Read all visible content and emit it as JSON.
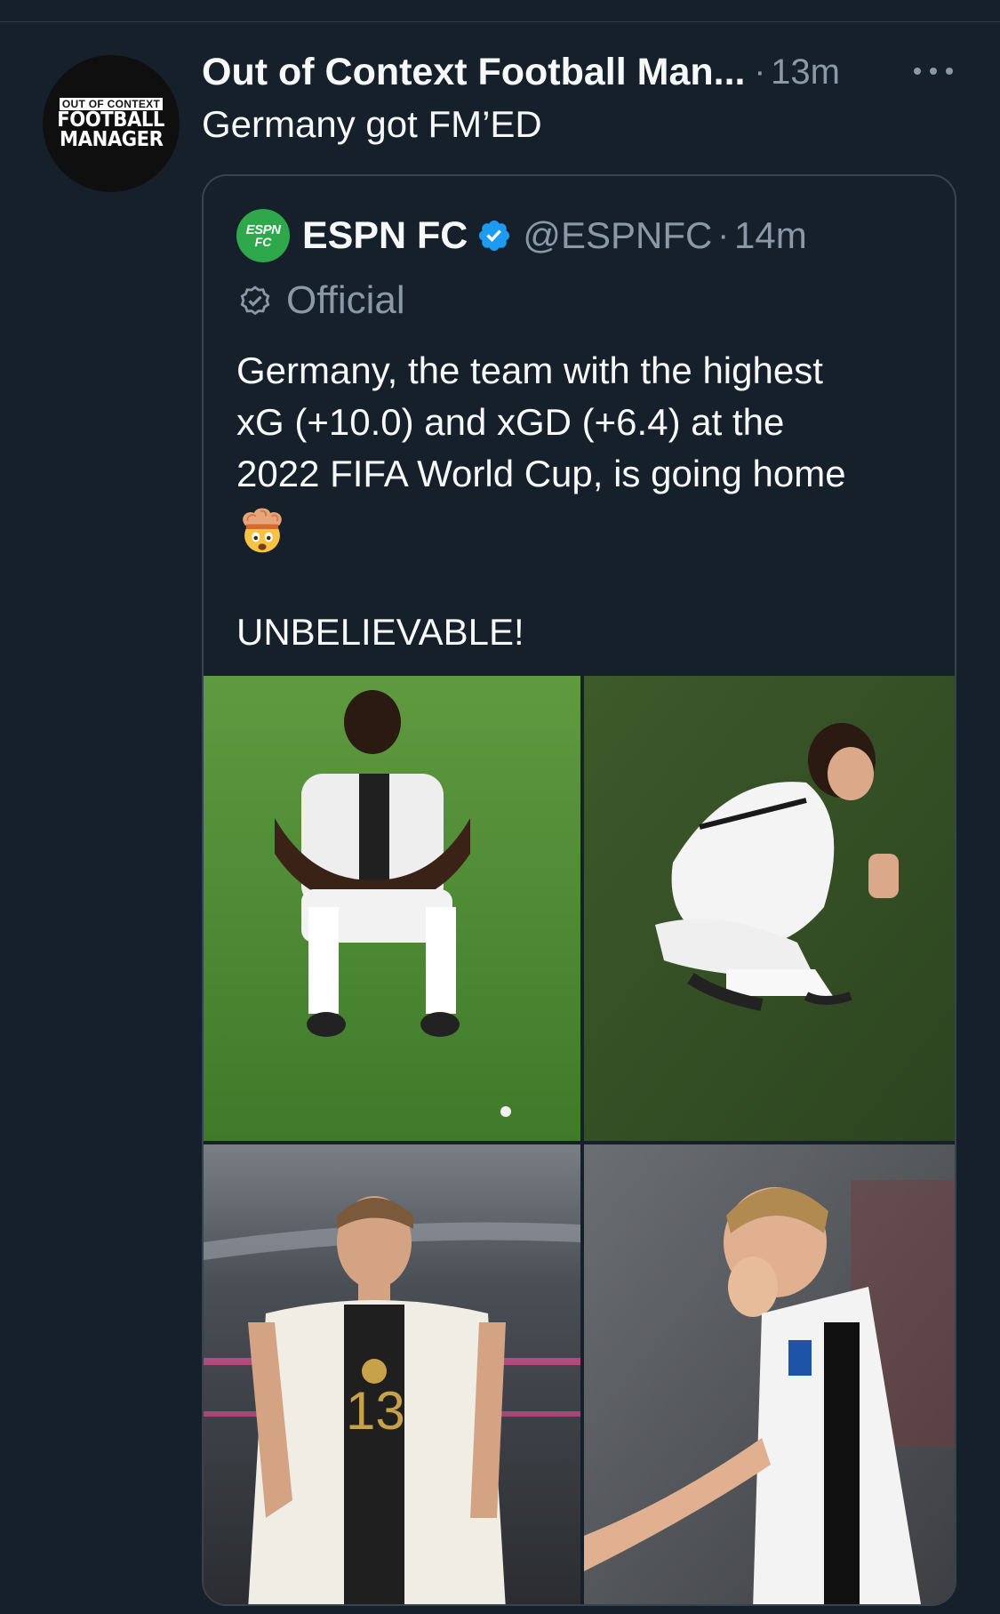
{
  "tweet": {
    "avatar_text": {
      "line1": "OUT OF CONTEXT",
      "line2": "FOOTBALL",
      "line3": "MANAGER"
    },
    "author_name": "Out of Context Football Man...",
    "separator": "·",
    "time": "13m",
    "more_icon": "more-horizontal-icon",
    "text": "Germany got FM’ED"
  },
  "quote": {
    "avatar_text": {
      "line1": "ESPN",
      "line2": "FC"
    },
    "name": "ESPN FC",
    "verified_icon": "verified-badge-icon",
    "handle": "@ESPNFC",
    "separator": "·",
    "time": "14m",
    "official_icon": "official-badge-icon",
    "official_label": "Official",
    "body_lines": [
      "Germany, the team with the highest",
      "xG (+10.0) and xGD (+6.4) at the",
      "2022 FIFA World Cup, is going home"
    ],
    "emoji": "exploding-head-emoji",
    "exclaim": "UNBELIEVABLE!",
    "media": [
      {
        "subject": "player-sitting-on-pitch"
      },
      {
        "subject": "player-crouching-on-pitch"
      },
      {
        "subject": "player-number-13-standing",
        "jersey_number": "13"
      },
      {
        "subject": "player-covering-face"
      }
    ]
  },
  "colors": {
    "background": "#15202b",
    "text_primary": "#f7f9f9",
    "text_secondary": "#8b98a5",
    "border": "#38444d",
    "verified_blue": "#1d9bf0",
    "espn_green": "#2ea84a"
  }
}
